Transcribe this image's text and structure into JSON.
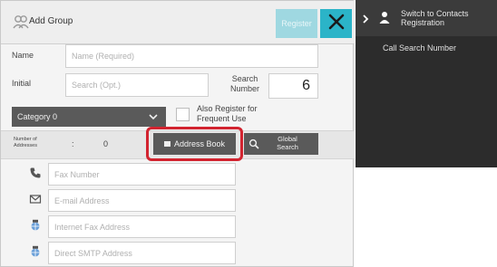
{
  "dialog": {
    "title": "Add Group",
    "register_label": "Register",
    "name_label": "Name",
    "name_placeholder": "Name (Required)",
    "initial_label": "Initial",
    "initial_placeholder": "Search (Opt.)",
    "search_number_label": "Search Number",
    "search_number_value": "6",
    "category_value": "Category 0",
    "frequent_use_label": "Also Register for Frequent Use",
    "addresses_count_label": "Number of Addresses",
    "colon": ":",
    "addresses_count_value": "0",
    "address_book_label": "Address Book",
    "global_search_label": "Global Search",
    "fax_placeholder": "Fax Number",
    "email_placeholder": "E-mail Address",
    "ifax_placeholder": "Internet Fax Address",
    "smtp_placeholder": "Direct SMTP Address"
  },
  "side_panel": {
    "switch_label": "Switch to Contacts Registration",
    "call_search_label": "Call Search Number"
  },
  "colors": {
    "accent": "#2bb4c8",
    "highlight": "#d2232f",
    "dark_button": "#5a5a5a"
  },
  "icons": {
    "title": "group-icon",
    "close": "close-icon",
    "category": "chevron-down-icon",
    "global_search": "search-icon",
    "fax": "phone-icon",
    "email": "envelope-icon",
    "ifax": "internet-fax-icon",
    "smtp": "smtp-globe-icon",
    "side_chev": "chevron-right-icon",
    "side_person": "person-icon"
  }
}
